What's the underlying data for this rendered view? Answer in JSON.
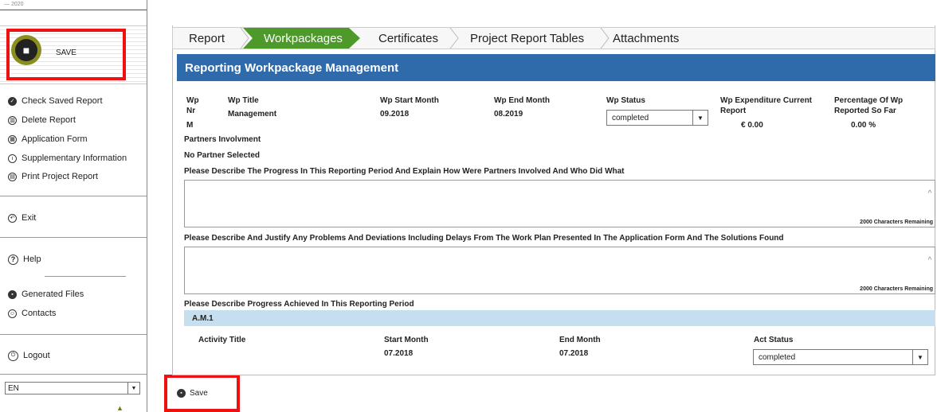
{
  "sidebar": {
    "top_label": "— 2020",
    "save_label": "SAVE",
    "menu": [
      {
        "label": "Check Saved Report",
        "icon": "check-circle-icon"
      },
      {
        "label": "Delete Report",
        "icon": "trash-icon"
      },
      {
        "label": "Application Form",
        "icon": "bank-icon"
      },
      {
        "label": "Supplementary Information",
        "icon": "info-icon"
      },
      {
        "label": "Print Project Report",
        "icon": "print-icon"
      },
      {
        "label": "Exit",
        "icon": "exit-icon"
      },
      {
        "label": "Help",
        "icon": "help-icon"
      },
      {
        "label": "Generated Files",
        "icon": "files-icon"
      },
      {
        "label": "Contacts",
        "icon": "contacts-icon"
      },
      {
        "label": "Logout",
        "icon": "power-icon"
      }
    ],
    "language": "EN"
  },
  "tabs": [
    "Report",
    "Workpackages",
    "Certificates",
    "Project Report Tables",
    "Attachments"
  ],
  "active_tab": "Workpackages",
  "header_title": "Reporting Workpackage Management",
  "wp": {
    "nr_label_1": "Wp",
    "nr_label_2": "Nr",
    "nr_value": "M",
    "title_label": "Wp Title",
    "title_value": "Management",
    "start_label": "Wp Start Month",
    "start_value": "09.2018",
    "end_label": "Wp End Month",
    "end_value": "08.2019",
    "status_label": "Wp Status",
    "status_value": "completed",
    "expenditure_label_1": "Wp Expenditure Current",
    "expenditure_label_2": "Report",
    "expenditure_value": "€ 0.00",
    "percentage_label_1": "Percentage Of Wp",
    "percentage_label_2": "Reported So Far",
    "percentage_value": "0.00 %",
    "partners_label": "Partners Involvment",
    "partners_value": "No Partner Selected"
  },
  "questions": {
    "progress": "Please Describe The Progress In This Reporting Period And Explain How Were Partners Involved And Who Did What",
    "problems": "Please Describe And Justify Any Problems And Deviations Including Delays From The Work Plan Presented In The Application Form And The Solutions Found",
    "achieved": "Please Describe Progress Achieved In This Reporting Period",
    "remaining_1": "2000 Characters Remaining",
    "remaining_2": "2000 Characters Remaining"
  },
  "activity": {
    "code": "A.M.1",
    "title_label": "Activity Title",
    "start_label": "Start Month",
    "start_value": "07.2018",
    "end_label": "End Month",
    "end_value": "07.2018",
    "status_label": "Act Status",
    "status_value": "completed"
  },
  "bottom_save_label": "Save",
  "colors": {
    "accent_green": "#4d9a2b",
    "header_blue": "#2f6aab",
    "activity_blue": "#c5dff0",
    "highlight_red": "#e11"
  }
}
